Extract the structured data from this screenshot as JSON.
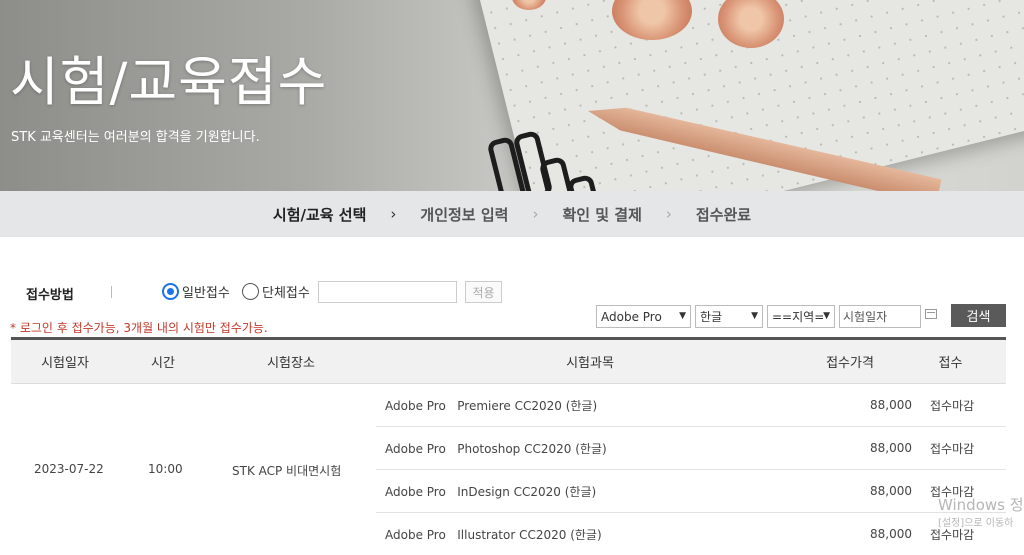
{
  "hero": {
    "title": "시험/교육접수",
    "subtitle": "STK 교육센터는 여러분의 합격을 기원합니다."
  },
  "steps": [
    {
      "label": "시험/교육 선택",
      "active": true
    },
    {
      "label": "개인정보 입력",
      "active": false
    },
    {
      "label": "확인 및 결제",
      "active": false
    },
    {
      "label": "접수완료",
      "active": false
    }
  ],
  "form": {
    "method_label": "접수방법",
    "radio_general": "일반접수",
    "radio_group": "단체접수",
    "group_input_value": "",
    "apply_label": "적용",
    "notice": "* 로그인 후 접수가능, 3개월 내의 시험만 접수가능.",
    "select_product": "Adobe Pro",
    "select_language": "한글",
    "select_region": "==지역=",
    "date_placeholder": "시험일자",
    "search_label": "검색"
  },
  "table": {
    "headers": [
      "시험일자",
      "시간",
      "시험장소",
      "시험과목",
      "접수가격",
      "접수"
    ],
    "group": {
      "date": "2023-07-22",
      "time": "10:00",
      "place": "STK ACP 비대면시험"
    },
    "rows": [
      {
        "subject": "Adobe Pro   Premiere CC2020 (한글)",
        "price": "88,000",
        "status": "접수마감"
      },
      {
        "subject": "Adobe Pro   Photoshop CC2020 (한글)",
        "price": "88,000",
        "status": "접수마감"
      },
      {
        "subject": "Adobe Pro   InDesign CC2020 (한글)",
        "price": "88,000",
        "status": "접수마감"
      },
      {
        "subject": "Adobe Pro   Illustrator CC2020 (한글)",
        "price": "88,000",
        "status": "접수마감"
      }
    ]
  },
  "watermark": {
    "line1": "Windows 정",
    "line2": "[설정]으로 이동하"
  }
}
